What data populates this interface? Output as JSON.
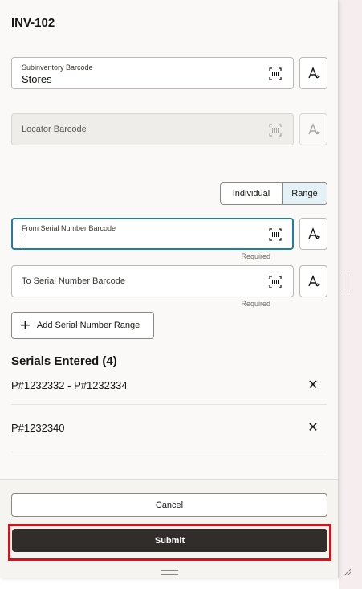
{
  "header": {
    "title": "INV-102"
  },
  "fields": {
    "subinventory": {
      "label": "Subinventory Barcode",
      "value": "Stores"
    },
    "locator": {
      "placeholder": "Locator Barcode"
    },
    "from_serial": {
      "label": "From Serial Number Barcode",
      "required": "Required"
    },
    "to_serial": {
      "placeholder": "To Serial Number Barcode",
      "required": "Required"
    }
  },
  "mode_toggle": {
    "individual": "Individual",
    "range": "Range",
    "selected": "Range"
  },
  "add_range_button": {
    "label": "Add Serial Number Range",
    "icon": "plus-icon"
  },
  "serials": {
    "heading": "Serials Entered (4)",
    "items": [
      {
        "text": "P#1232332 - P#1232334"
      },
      {
        "text": "P#1232340"
      }
    ]
  },
  "footer": {
    "cancel": "Cancel",
    "submit": "Submit"
  },
  "colors": {
    "accent": "#227e9e",
    "submit_bg": "#312d2a",
    "highlight": "#d0141c",
    "selected_segment": "#e4f1f7"
  },
  "icons": {
    "scan": "barcode-scan-icon",
    "keyboard": "text-input-icon",
    "remove": "close-icon"
  }
}
